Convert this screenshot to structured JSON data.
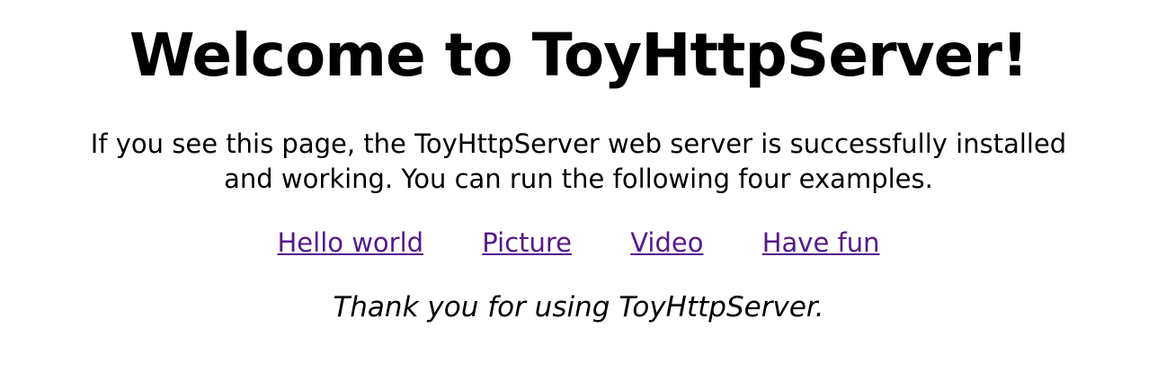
{
  "page": {
    "title": "Welcome to ToyHttpServer!",
    "intro": "If you see this page, the ToyHttpServer web server is successfully installed and working. You can run the following four examples.",
    "links": [
      {
        "label": "Hello world"
      },
      {
        "label": "Picture"
      },
      {
        "label": "Video"
      },
      {
        "label": "Have fun"
      }
    ],
    "thanks": "Thank you for using ToyHttpServer."
  },
  "colors": {
    "visited_link": "#551a8b",
    "text": "#000000",
    "background": "#ffffff"
  }
}
